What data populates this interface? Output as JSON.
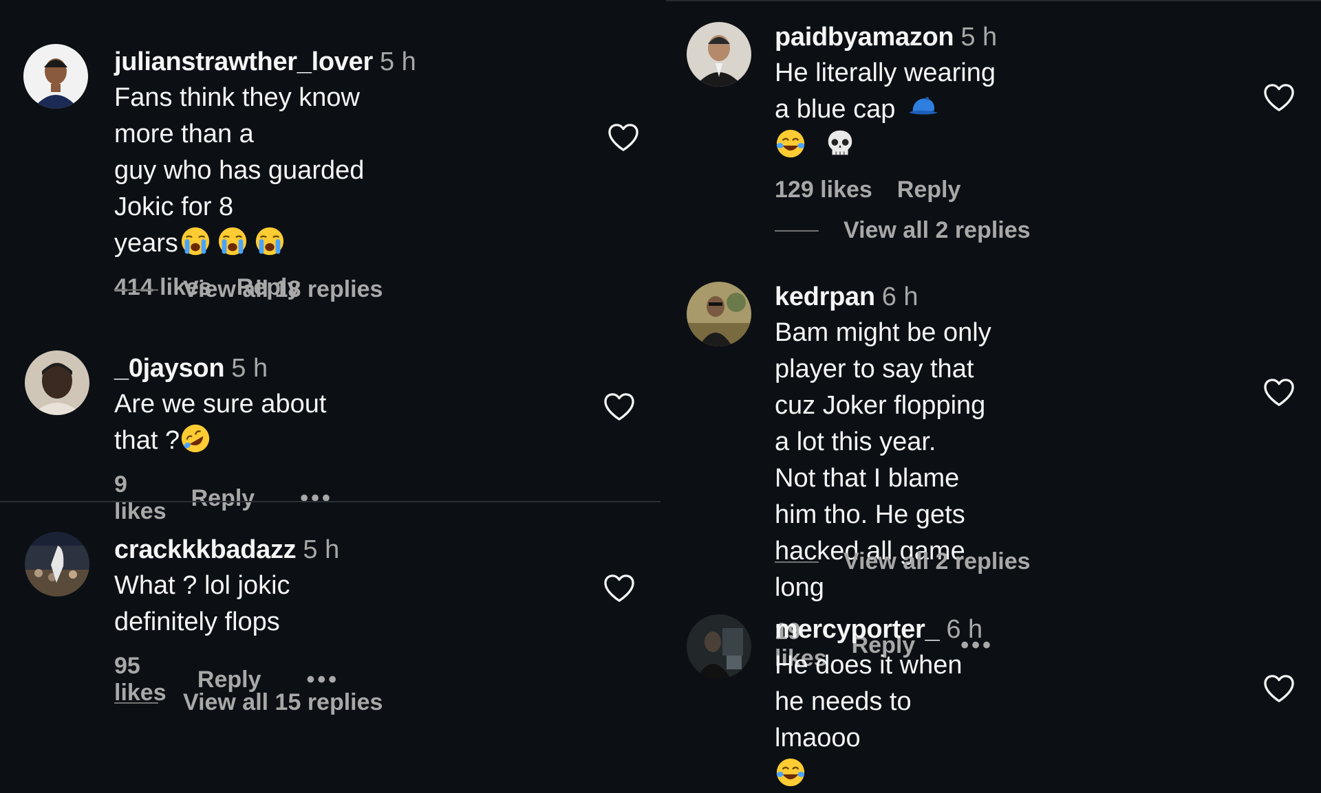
{
  "left": {
    "comments": [
      {
        "username": "julianstrawther_lover",
        "time": "5 h",
        "text": "Fans think they know more than a\nguy who has guarded Jokic for 8\nyears",
        "emojis": [
          "crying-emoji",
          "crying-emoji",
          "crying-emoji"
        ],
        "likes": "414 likes",
        "reply": "Reply",
        "view_replies": "View all 18 replies"
      },
      {
        "username": "_0jayson",
        "time": "5 h",
        "text": "Are we sure about that ?",
        "emojis": [
          "rofl-emoji"
        ],
        "likes": "9 likes",
        "reply": "Reply",
        "more": "•••"
      },
      {
        "username": "crackkkbadazz",
        "time": "5 h",
        "text": "What ? lol jokic definitely flops",
        "likes": "95 likes",
        "reply": "Reply",
        "more": "•••",
        "view_replies": "View all 15 replies"
      }
    ]
  },
  "right": {
    "comments": [
      {
        "username": "paidbyamazon",
        "time": "5 h",
        "text": "He literally wearing a blue cap",
        "emojis": [
          "blue-cap-emoji",
          "joy-emoji",
          "skull-emoji"
        ],
        "likes": "129 likes",
        "reply": "Reply",
        "view_replies": "View all 2 replies"
      },
      {
        "username": "kedrpan",
        "time": "6 h",
        "text": "Bam might be only player to say that\ncuz Joker flopping a lot this year.\nNot that I blame him tho. He gets\nhacked all game long",
        "likes": "19 likes",
        "reply": "Reply",
        "more": "•••",
        "view_replies": "View all 2 replies"
      },
      {
        "username": "mercyporter_",
        "time": "6 h",
        "text": "He does it when he needs to lmaooo",
        "emojis": [
          "joy-emoji"
        ]
      }
    ]
  },
  "colors": {
    "background": "#0c1014",
    "text": "#f5f5f5",
    "muted": "#a8a8a8"
  },
  "icons": {
    "like": "heart-outline-icon"
  }
}
